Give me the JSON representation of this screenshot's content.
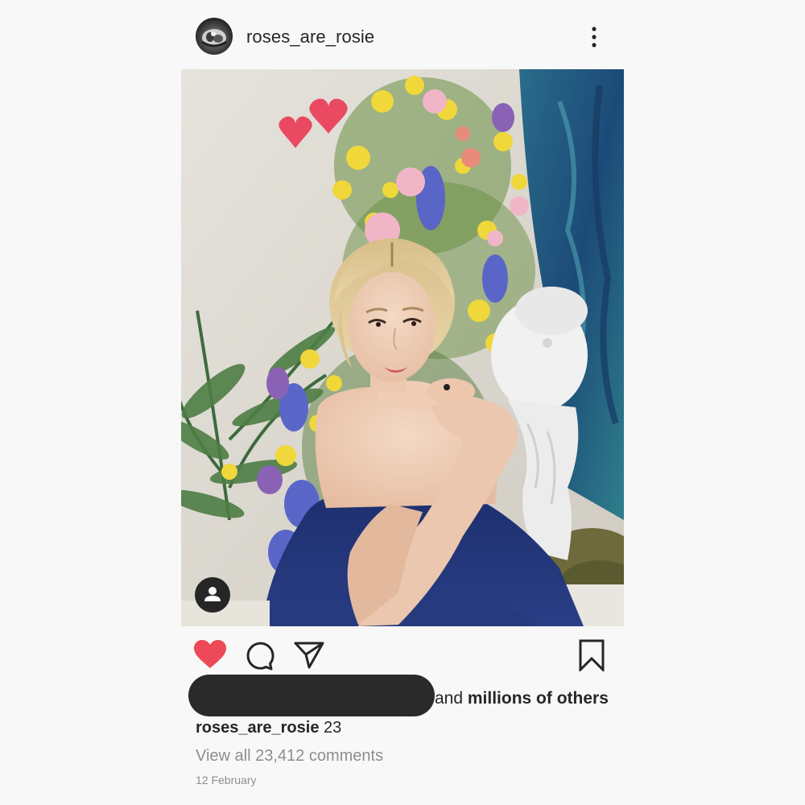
{
  "post": {
    "username": "roses_are_rosie",
    "more_icon": "more-vertical-icon",
    "avatar_icon": "profile-avatar",
    "photo": {
      "description_icon": "photo",
      "liked_hearts_icon": "heart-stickers",
      "tag_icon": "user-tag-icon"
    },
    "actions": {
      "like_icon": "heart-filled-icon",
      "like_color": "#ed4956",
      "comment_icon": "comment-icon",
      "share_icon": "send-icon",
      "save_icon": "bookmark-icon"
    },
    "likes": {
      "prefix": "and ",
      "bold": "millions of others"
    },
    "caption": {
      "user": "roses_are_rosie",
      "text": " 23"
    },
    "comments_link": "View all 23,412 comments",
    "date": "12 February"
  }
}
